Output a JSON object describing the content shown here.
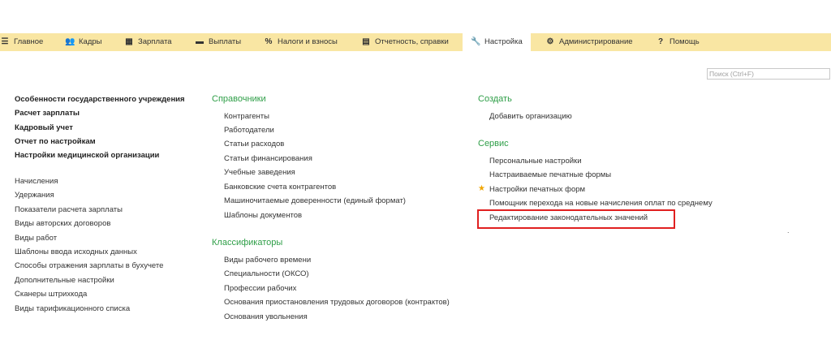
{
  "menu": [
    {
      "label": "Главное",
      "icon": "hamburger-icon",
      "glyph": "☰"
    },
    {
      "label": "Кадры",
      "icon": "people-icon",
      "glyph": "👥"
    },
    {
      "label": "Зарплата",
      "icon": "calculator-icon",
      "glyph": "▦"
    },
    {
      "label": "Выплаты",
      "icon": "money-icon",
      "glyph": "▬"
    },
    {
      "label": "Налоги и взносы",
      "icon": "percent-icon",
      "glyph": "%"
    },
    {
      "label": "Отчетность, справки",
      "icon": "report-icon",
      "glyph": "▤"
    },
    {
      "label": "Настройка",
      "icon": "wrench-icon",
      "glyph": "🔧"
    },
    {
      "label": "Администрирование",
      "icon": "gear-icon",
      "glyph": "⚙"
    },
    {
      "label": "Помощь",
      "icon": "help-icon",
      "glyph": "?"
    }
  ],
  "search": {
    "placeholder": "Поиск (Ctrl+F)"
  },
  "col1": {
    "bold": [
      "Особенности государственного учреждения",
      "Расчет зарплаты",
      "Кадровый учет",
      "Отчет по настройкам",
      "Настройки медицинской организации"
    ],
    "items": [
      "Начисления",
      "Удержания",
      "Показатели расчета зарплаты",
      "Виды авторских договоров",
      "Виды работ",
      "Шаблоны ввода исходных данных",
      "Способы отражения зарплаты в бухучете",
      "Дополнительные настройки",
      "Сканеры штрихкода",
      "Виды тарификационного списка"
    ]
  },
  "col2": {
    "h1": "Справочники",
    "items1": [
      "Контрагенты",
      "Работодатели",
      "Статьи расходов",
      "Статьи финансирования",
      "Учебные заведения",
      "Банковские счета контрагентов",
      "Машиночитаемые доверенности (единый формат)",
      "Шаблоны документов"
    ],
    "h2": "Классификаторы",
    "items2": [
      "Виды рабочего времени",
      "Специальности (ОКСО)",
      "Профессии рабочих",
      "Основания приостановления трудовых договоров (контрактов)",
      "Основания увольнения"
    ]
  },
  "col3": {
    "h1": "Создать",
    "items1": [
      "Добавить организацию"
    ],
    "h2": "Сервис",
    "items2": [
      "Персональные настройки",
      "Настраиваемые печатные формы",
      "Настройки печатных форм",
      "Помощник перехода на новые начисления оплат по среднему",
      "Редактирование законодательных значений"
    ]
  },
  "colors": {
    "menubar": "#f9e6a3",
    "section_heading": "#2e9e47",
    "highlight": "#e02020",
    "star": "#f0a500"
  }
}
